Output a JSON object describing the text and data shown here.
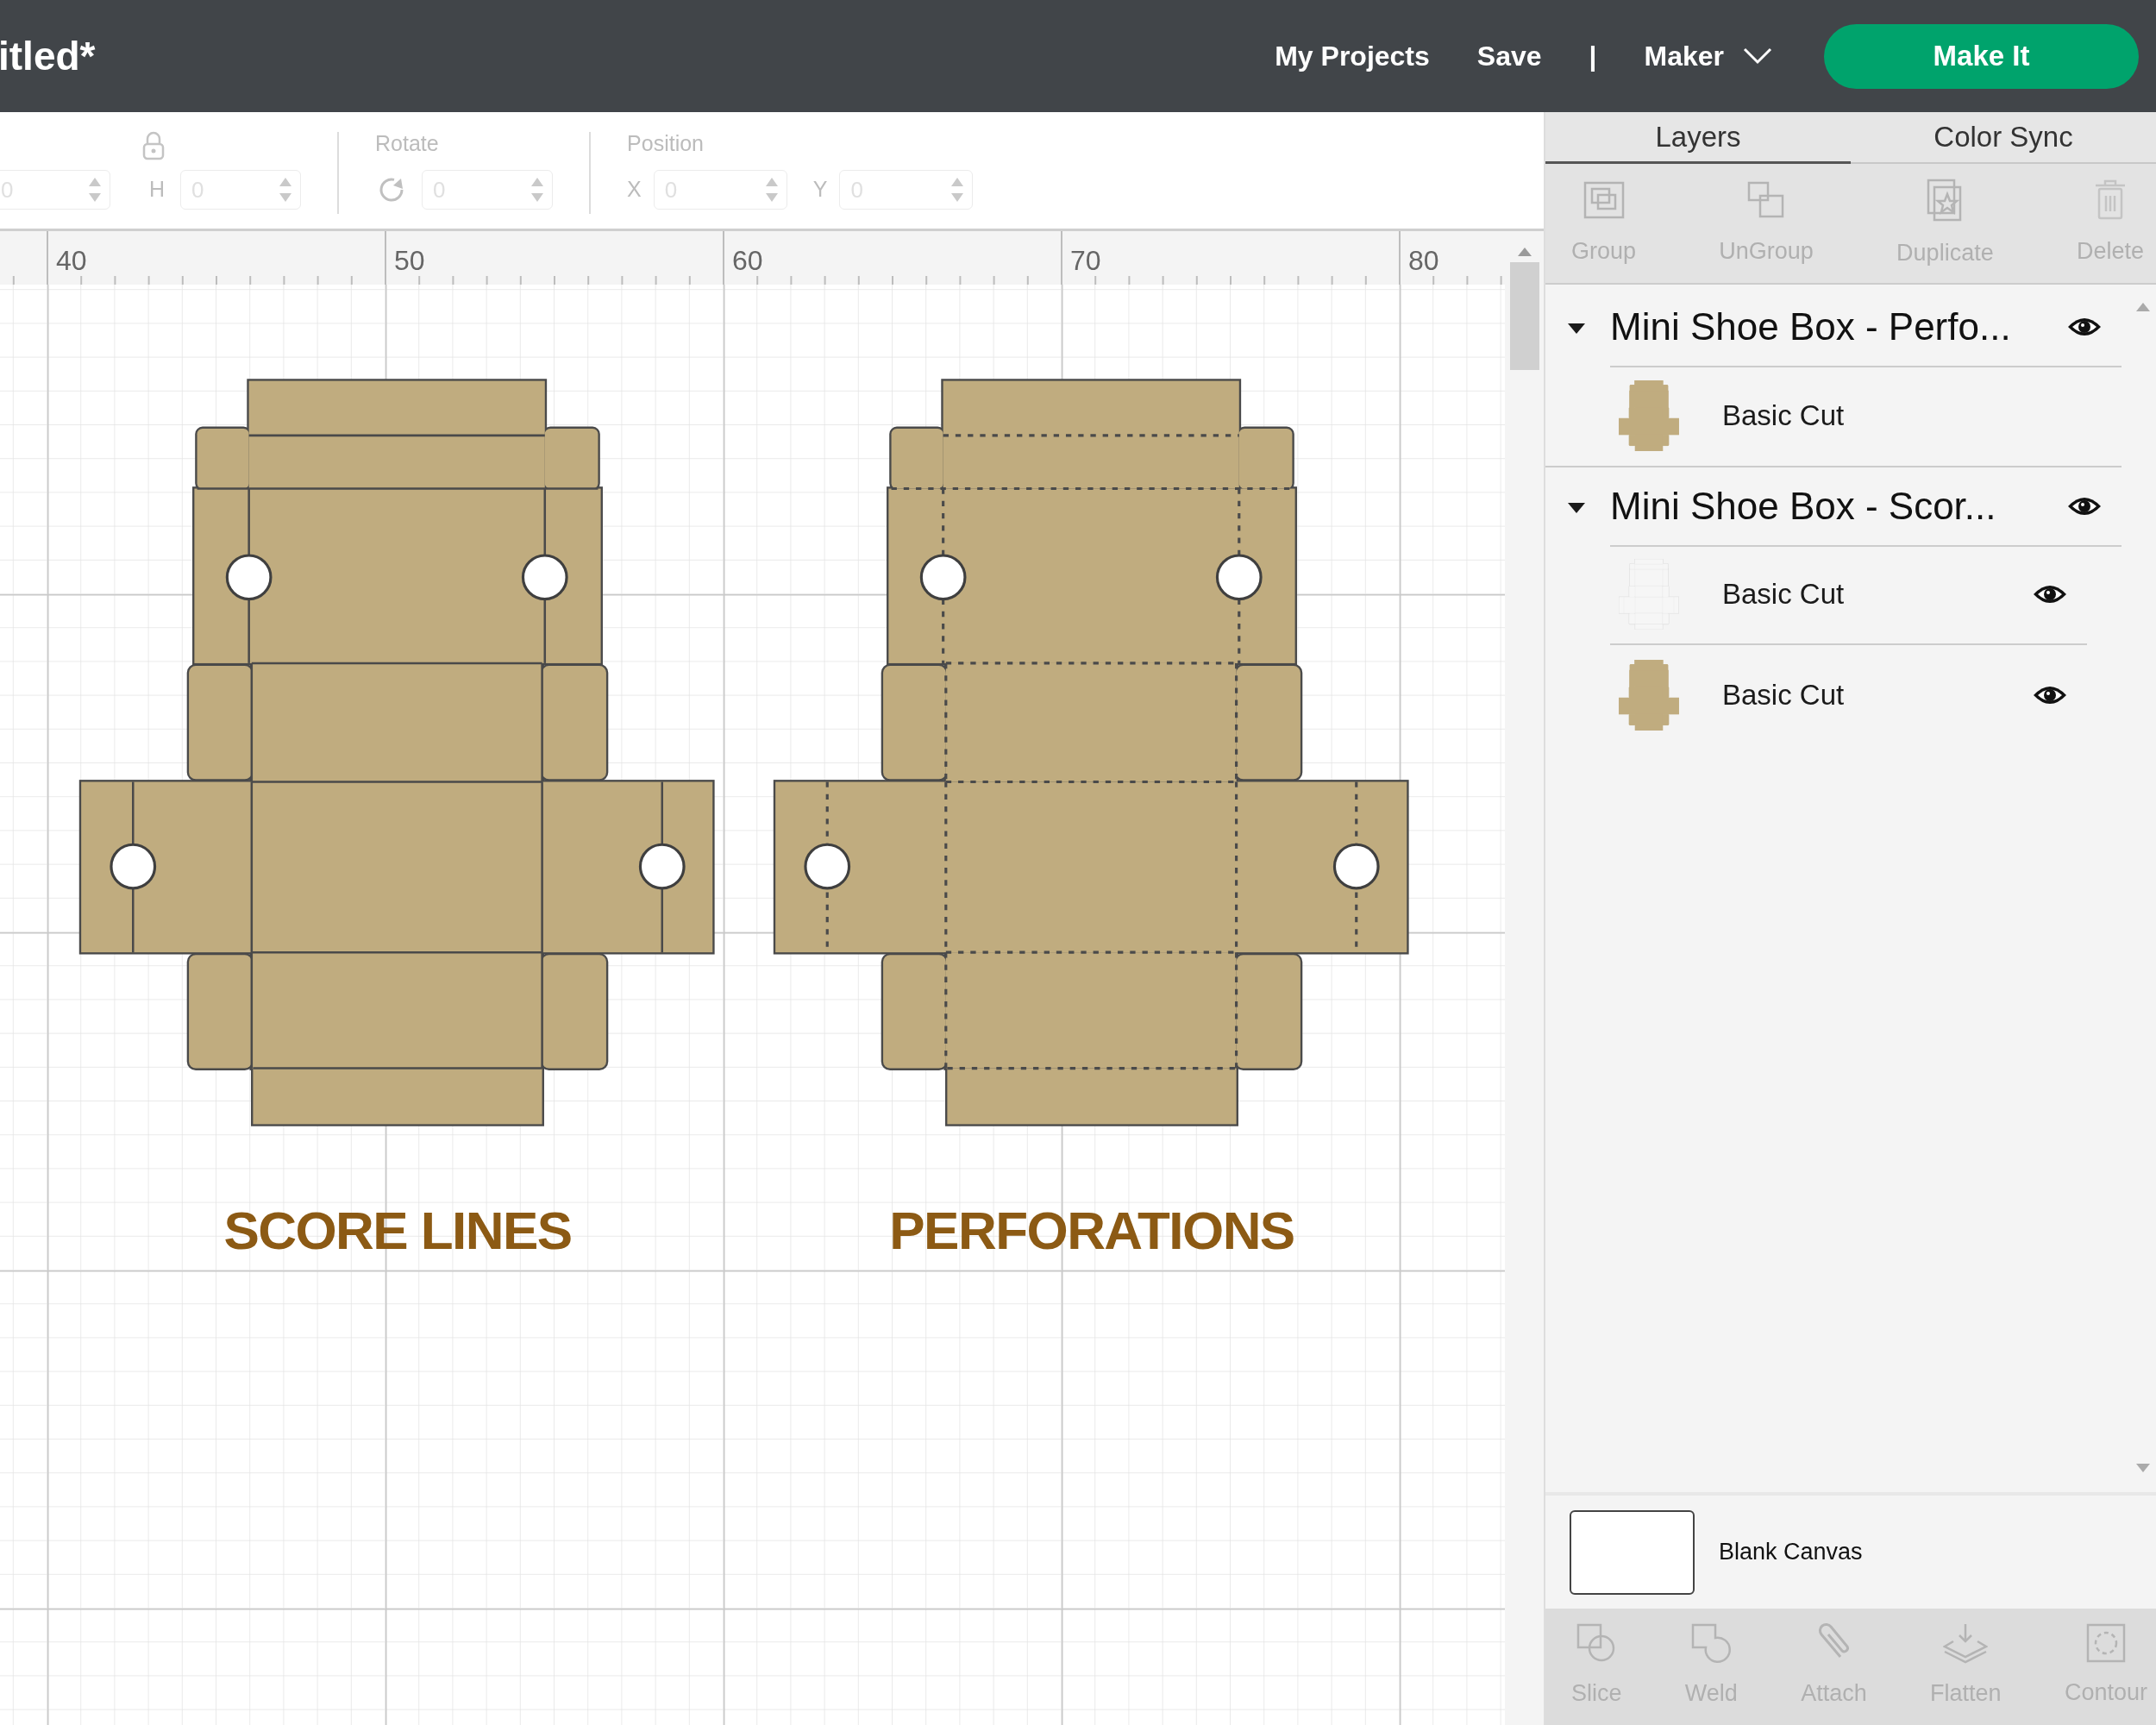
{
  "header": {
    "title": "itled*",
    "nav": [
      "My Projects",
      "Save",
      "|"
    ],
    "machine": "Maker",
    "make_button": "Make It"
  },
  "edit_toolbar": {
    "w_value": "0",
    "h_label": "H",
    "h_value": "0",
    "rotate_label": "Rotate",
    "rotate_value": "0",
    "position_label": "Position",
    "x_label": "X",
    "x_value": "0",
    "y_label": "Y",
    "y_value": "0"
  },
  "ruler": [
    "40",
    "50",
    "60",
    "70",
    "80"
  ],
  "canvas": {
    "designs": [
      {
        "label": "SCORE LINES",
        "kind": "score"
      },
      {
        "label": "PERFORATIONS",
        "kind": "perforation"
      }
    ]
  },
  "panel": {
    "tabs": [
      {
        "label": "Layers",
        "selected": true
      },
      {
        "label": "Color Sync",
        "selected": false
      }
    ],
    "layer_actions": [
      {
        "label": "Group",
        "disabled": true
      },
      {
        "label": "UnGroup",
        "disabled": true
      },
      {
        "label": "Duplicate",
        "disabled": true
      },
      {
        "label": "Delete",
        "disabled": true
      }
    ],
    "layers": [
      {
        "name": "Mini Shoe Box - Perfo...",
        "expanded": true,
        "eye": true,
        "children": [
          {
            "name": "Basic Cut",
            "kind": "filled",
            "eye": false
          }
        ]
      },
      {
        "name": "Mini Shoe Box - Scor...",
        "expanded": true,
        "eye": true,
        "children": [
          {
            "name": "Basic Cut",
            "kind": "outline",
            "eye": true
          },
          {
            "name": "Basic Cut",
            "kind": "filled",
            "eye": true
          }
        ]
      }
    ],
    "canvas_label": "Blank Canvas",
    "bottom_actions": [
      {
        "label": "Slice",
        "disabled": true
      },
      {
        "label": "Weld",
        "disabled": true
      },
      {
        "label": "Attach",
        "disabled": true
      },
      {
        "label": "Flatten",
        "disabled": true
      },
      {
        "label": "Contour",
        "disabled": true
      }
    ]
  }
}
